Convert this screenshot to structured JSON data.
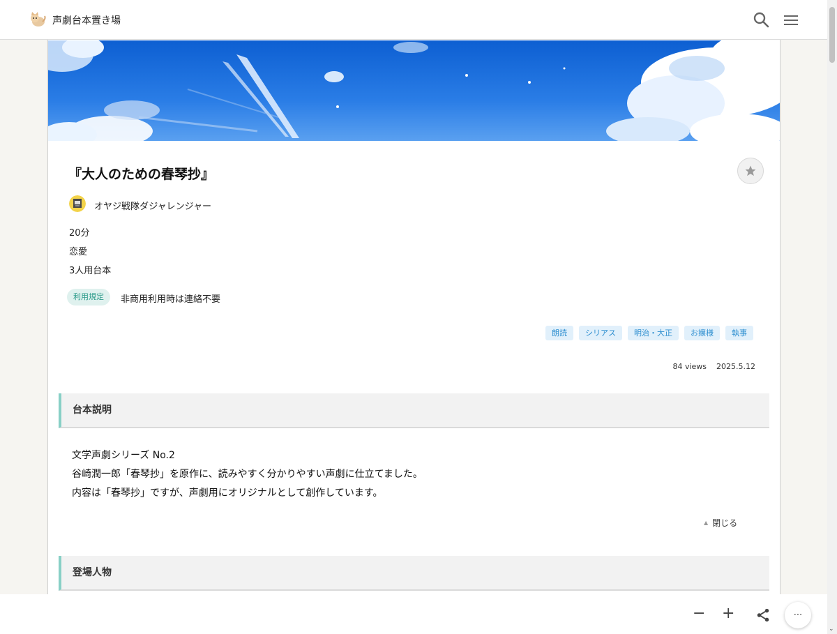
{
  "header": {
    "site_title": "声劇台本置き場",
    "logo_icon": "cat-logo-icon",
    "search_icon": "search-icon",
    "menu_icon": "hamburger-menu-icon"
  },
  "script": {
    "title": "『大人のための春琴抄』",
    "author": "オヤジ戦隊ダジャレンジャー",
    "duration": "20分",
    "genre": "恋愛",
    "cast": "3人用台本",
    "license_label": "利用規定",
    "license_text": "非商用利用時は連絡不要",
    "tags": [
      "朗読",
      "シリアス",
      "明治・大正",
      "お嬢様",
      "執事"
    ],
    "views": "84 views",
    "date": "2025.5.12"
  },
  "sections": {
    "description_heading": "台本説明",
    "description_lines": [
      "文学声劇シリーズ No.2",
      "谷崎潤一郎「春琴抄」を原作に、読みやすく分かりやすい声劇に仕立てました。",
      "内容は「春琴抄」ですが、声劇用にオリジナルとして創作しています。"
    ],
    "collapse_label": "閉じる",
    "characters_heading": "登場人物"
  },
  "bottom": {
    "zoom_out": "−",
    "zoom_in": "+",
    "more": "···"
  },
  "colors": {
    "accent_teal": "#88d0c6",
    "tag_blue": "#2f8fd0",
    "tag_bg": "#e1f0fb",
    "license_bg": "#dff1ee",
    "sky_blue": "#1c6fd8"
  }
}
